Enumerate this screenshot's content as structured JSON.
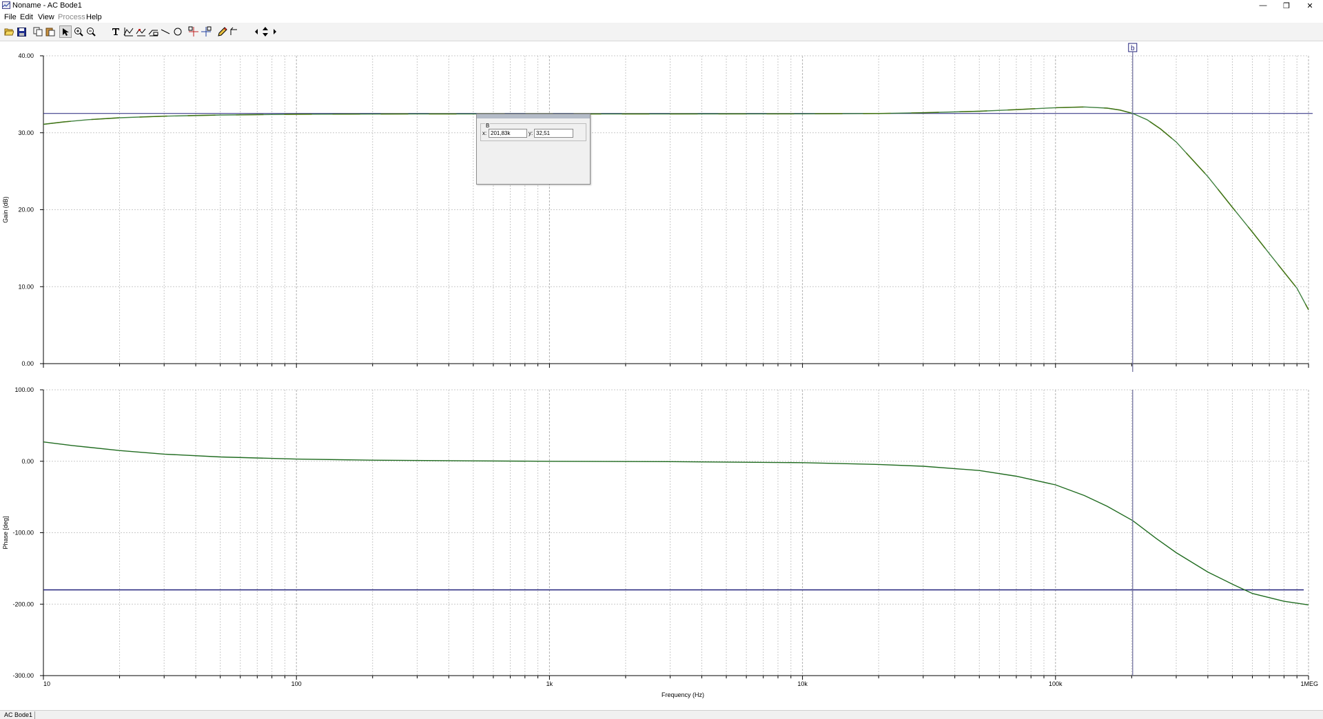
{
  "window": {
    "title": "Noname - AC Bode1",
    "minimize_glyph": "—",
    "maximize_glyph": "❐",
    "close_glyph": "✕"
  },
  "menu": {
    "items": [
      {
        "label": "File",
        "enabled": true
      },
      {
        "label": "Edit",
        "enabled": true
      },
      {
        "label": "View",
        "enabled": true
      },
      {
        "label": "Process",
        "enabled": false
      },
      {
        "label": "Help",
        "enabled": true
      }
    ]
  },
  "toolbar": {
    "icons": [
      "open-icon",
      "save-icon",
      "copy-icon",
      "paste-icon",
      "select-arrow-icon",
      "zoom-in-icon",
      "zoom-reset-icon",
      "text-tool-icon",
      "curve-edit-icon",
      "curve-marker-icon",
      "curve-label-icon",
      "line-tool-icon",
      "ellipse-tool-icon",
      "cursor-a-icon",
      "cursor-b-icon",
      "pencil-icon",
      "marker-tool-icon",
      "step-left-icon",
      "up-down-icon",
      "step-right-icon"
    ],
    "pressed": "select-arrow-icon"
  },
  "colors": {
    "trace": "#1f6b1f",
    "trace_overlay": "#b8a020",
    "reference_line": "#20207a",
    "cursor_line": "#6a6a9a",
    "grid": "#c8c8c8",
    "axis": "#000000"
  },
  "chart_data": [
    {
      "type": "line",
      "id": "gain",
      "ylabel": "Gain (dB)",
      "xscale": "log",
      "xlim": [
        10,
        1000000
      ],
      "ylim": [
        0,
        40
      ],
      "yticks": [
        "0.00",
        "10.00",
        "20.00",
        "30.00",
        "40.00"
      ],
      "ytick_values": [
        0,
        10,
        20,
        30,
        40
      ],
      "grid": true,
      "series": [
        {
          "points": [
            [
              10,
              31.1
            ],
            [
              12,
              31.4
            ],
            [
              15,
              31.7
            ],
            [
              20,
              31.95
            ],
            [
              30,
              32.15
            ],
            [
              50,
              32.3
            ],
            [
              100,
              32.4
            ],
            [
              300,
              32.45
            ],
            [
              1000,
              32.45
            ],
            [
              3000,
              32.45
            ],
            [
              10000,
              32.46
            ],
            [
              20000,
              32.5
            ],
            [
              30000,
              32.6
            ],
            [
              50000,
              32.8
            ],
            [
              70000,
              33.0
            ],
            [
              100000,
              33.25
            ],
            [
              130000,
              33.35
            ],
            [
              160000,
              33.2
            ],
            [
              180000,
              32.95
            ],
            [
              201830,
              32.51
            ],
            [
              230000,
              31.7
            ],
            [
              260000,
              30.5
            ],
            [
              300000,
              28.8
            ],
            [
              400000,
              24.3
            ],
            [
              500000,
              20.3
            ],
            [
              600000,
              17.1
            ],
            [
              700000,
              14.3
            ],
            [
              800000,
              11.9
            ],
            [
              900000,
              9.8
            ],
            [
              1000000,
              7.0
            ]
          ]
        }
      ],
      "reference_y": 32.51
    },
    {
      "type": "line",
      "id": "phase",
      "xlabel": "Frequency (Hz)",
      "ylabel": "Phase [deg]",
      "xscale": "log",
      "xlim": [
        10,
        1000000
      ],
      "ylim": [
        -300,
        100
      ],
      "yticks": [
        "-300.00",
        "-200.00",
        "-100.00",
        "0.00",
        "100.00"
      ],
      "ytick_values": [
        -300,
        -200,
        -100,
        0,
        100
      ],
      "xticks": [
        "10",
        "100",
        "1k",
        "10k",
        "100k",
        "1MEG"
      ],
      "xtick_values": [
        10,
        100,
        1000,
        10000,
        100000,
        1000000
      ],
      "grid": true,
      "series": [
        {
          "points": [
            [
              10,
              27
            ],
            [
              13,
              22
            ],
            [
              20,
              15
            ],
            [
              30,
              10
            ],
            [
              50,
              6
            ],
            [
              100,
              3
            ],
            [
              200,
              1.5
            ],
            [
              500,
              0.5
            ],
            [
              1000,
              0
            ],
            [
              3000,
              -0.5
            ],
            [
              10000,
              -2
            ],
            [
              20000,
              -4.5
            ],
            [
              30000,
              -7
            ],
            [
              50000,
              -13
            ],
            [
              70000,
              -21
            ],
            [
              100000,
              -33
            ],
            [
              130000,
              -48
            ],
            [
              160000,
              -63
            ],
            [
              201830,
              -83
            ],
            [
              250000,
              -108
            ],
            [
              300000,
              -128
            ],
            [
              400000,
              -155
            ],
            [
              500000,
              -172
            ],
            [
              600000,
              -185
            ],
            [
              800000,
              -196
            ],
            [
              1000000,
              -201
            ]
          ]
        }
      ],
      "reference_y": -180
    }
  ],
  "cursor": {
    "label": "b",
    "x": 201830
  },
  "cursor_popup": {
    "name": "B",
    "x_label": "x:",
    "x_value": "201,83k",
    "y_label": "y:",
    "y_value": "32,51"
  },
  "status": {
    "tab": "AC Bode1"
  }
}
